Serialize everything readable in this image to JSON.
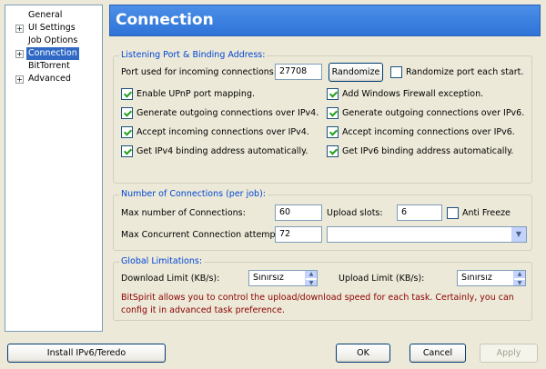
{
  "tree": [
    {
      "label": "General",
      "expander": "",
      "selected": false
    },
    {
      "label": "UI Settings",
      "expander": "+",
      "selected": false
    },
    {
      "label": "Job Options",
      "expander": "",
      "selected": false
    },
    {
      "label": "Connection",
      "expander": "+",
      "selected": true
    },
    {
      "label": "BitTorrent",
      "expander": "",
      "selected": false
    },
    {
      "label": "Advanced",
      "expander": "+",
      "selected": false
    }
  ],
  "header": {
    "title": "Connection"
  },
  "listening": {
    "title": "Listening Port & Binding Address:",
    "port_label": "Port used for incoming connections:",
    "port_value": "27708",
    "randomize_label": "Randomize",
    "randomize_each_start": {
      "label": "Randomize port each start.",
      "checked": false
    },
    "checks": [
      {
        "label": "Enable UPnP port mapping.",
        "checked": true
      },
      {
        "label": "Add Windows Firewall exception.",
        "checked": true
      },
      {
        "label": "Generate outgoing connections over IPv4.",
        "checked": true
      },
      {
        "label": "Generate outgoing connections over IPv6.",
        "checked": true
      },
      {
        "label": "Accept incoming connections over IPv4.",
        "checked": true
      },
      {
        "label": "Accept incoming connections over IPv6.",
        "checked": true
      },
      {
        "label": "Get IPv4 binding address automatically.",
        "checked": true
      },
      {
        "label": "Get IPv6 binding address automatically.",
        "checked": true
      }
    ]
  },
  "connections": {
    "title": "Number of Connections (per job):",
    "max_conn_label": "Max number of Connections:",
    "max_conn_value": "60",
    "upload_slots_label": "Upload slots:",
    "upload_slots_value": "6",
    "anti_freeze": {
      "label": "Anti Freeze",
      "checked": false
    },
    "max_concurrent_label": "Max Concurrent Connection attempt:",
    "max_concurrent_value": "72",
    "dropdown_value": ""
  },
  "limits": {
    "title": "Global Limitations:",
    "download_label": "Download Limit (KB/s):",
    "download_value": "Sınırsız",
    "upload_label": "Upload Limit (KB/s):",
    "upload_value": "Sınırsız",
    "note": "BitSpirit allows you to control the upload/download speed for each task. Certainly, you can config it in advanced task preference."
  },
  "footer": {
    "install_label": "Install IPv6/Teredo",
    "ok_label": "OK",
    "cancel_label": "Cancel",
    "apply_label": "Apply"
  },
  "icons": {
    "spin_up": "▲",
    "spin_down": "▼",
    "dropdown": "▼"
  },
  "colors": {
    "header": "#2F73D8",
    "group_title": "#0046D5",
    "note": "#8B0000",
    "selection": "#316AC5"
  }
}
